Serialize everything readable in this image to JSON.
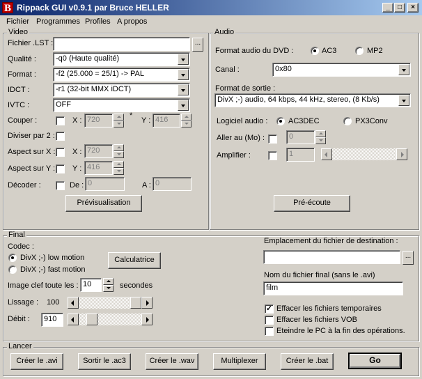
{
  "window": {
    "title": "Rippack GUI v0.9.1 par Bruce HELLER",
    "logo": "B"
  },
  "menu": [
    "Fichier",
    "Programmes",
    "Profiles",
    "A propos"
  ],
  "video": {
    "legend": "Video",
    "fichier_lst_label": "Fichier .LST :",
    "fichier_lst_value": "",
    "browse_label": "...",
    "qualite_label": "Qualité :",
    "qualite_value": "-q0 (Haute qualité)",
    "format_label": "Format :",
    "format_value": "-f2 (25.000 = 25/1) -> PAL",
    "idct_label": "IDCT :",
    "idct_value": "-r1  (32-bit MMX iDCT)",
    "ivtc_label": "IVTC :",
    "ivtc_value": "OFF",
    "couper_label": "Couper :",
    "x_label": "X :",
    "couper_x": "720",
    "star": "*",
    "y_label": "Y :",
    "couper_y": "416",
    "diviser_label": "Diviser par 2 :",
    "aspect_x_label": "Aspect sur X :",
    "aspect_x_value": "720",
    "aspect_y_label": "Aspect sur Y :",
    "aspect_y_value": "416",
    "decoder_label": "Décoder :",
    "de_label": "De :",
    "de_value": "0",
    "a_label": "A :",
    "a_value": "0",
    "preview_button": "Prévisualisation"
  },
  "audio": {
    "legend": "Audio",
    "format_label": "Format audio du DVD :",
    "ac3_label": "AC3",
    "mp2_label": "MP2",
    "canal_label": "Canal :",
    "canal_value": "0x80",
    "format_sortie_label": "Format de sortie :",
    "format_sortie_value": "DivX ;-) audio, 64 kbps, 44 kHz, stereo, (8 Kb/s)",
    "logiciel_label": "Logiciel audio :",
    "ac3dec_label": "AC3DEC",
    "px3conv_label": "PX3Conv",
    "aller_label": "Aller au (Mo) :",
    "aller_value": "0",
    "amplifier_label": "Amplifier :",
    "amplifier_value": "1",
    "preecoute_button": "Pré-écoute"
  },
  "final": {
    "legend": "Final",
    "codec_label": "Codec :",
    "codec_low": "DivX ;-) low motion",
    "codec_fast": "DivX ;-) fast motion",
    "calc_button": "Calculatrice",
    "keyframe_label": "Image clef toute les :",
    "keyframe_value": "10",
    "keyframe_unit": "secondes",
    "lissage_label": "Lissage :",
    "lissage_value": "100",
    "debit_label": "Débit :",
    "debit_value": "910",
    "dest_label": "Emplacement du fichier de destination :",
    "dest_value": "",
    "nom_label": "Nom du fichier final (sans le .avi)",
    "nom_value": "film",
    "opt_temp": "Effacer les fichiers temporaires",
    "opt_temp_checked": true,
    "opt_vob": "Effacer les fichiers VOB",
    "opt_eteindre": "Eteindre le PC à la fin des opérations."
  },
  "lancer": {
    "legend": "Lancer",
    "buttons": [
      "Créer le .avi",
      "Sortir le .ac3",
      "Créer le .wav",
      "Multiplexer",
      "Créer le .bat",
      "Go"
    ]
  }
}
